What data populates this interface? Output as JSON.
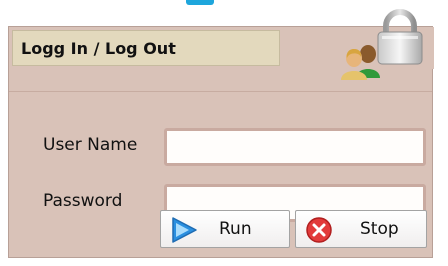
{
  "panel": {
    "title": "Logg In / Log Out"
  },
  "form": {
    "username_label": "User Name",
    "username_value": "",
    "password_label": "Password",
    "password_value": ""
  },
  "buttons": {
    "run_label": "Run",
    "stop_label": "Stop"
  },
  "icons": {
    "header_lock": "padlock-icon",
    "header_users": "users-icon",
    "run": "play-arrow-icon",
    "stop": "stop-x-icon"
  },
  "colors": {
    "panel_bg": "#d9c2b8",
    "title_tab_bg": "#e3d9bd",
    "input_border": "#c9aaa0",
    "accent": "#1ea6dc",
    "run_icon": "#2a8fe0",
    "stop_icon": "#e23b3b"
  }
}
